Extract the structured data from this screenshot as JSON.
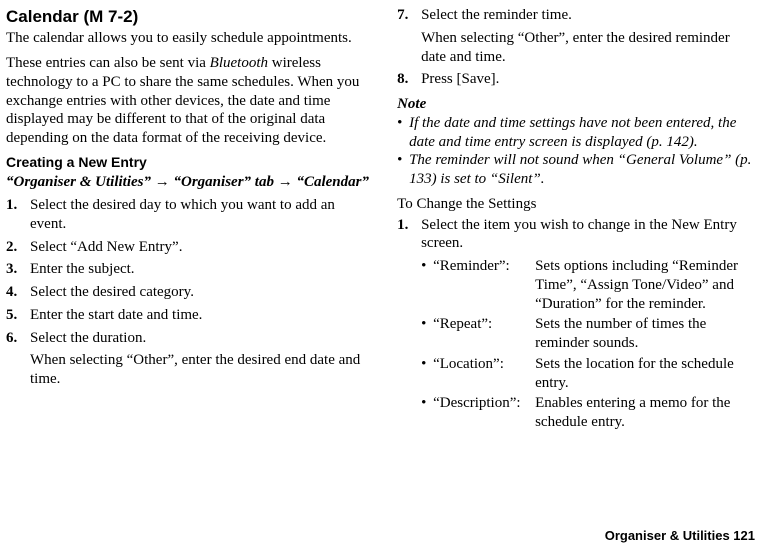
{
  "left": {
    "title": "Calendar",
    "menuCode": "(M 7-2)",
    "intro1": "The calendar allows you to easily schedule appointments.",
    "intro2_pre": "These entries can also be sent via ",
    "intro2_em": "Bluetooth",
    "intro2_post": " wireless technology to a PC to share the same schedules. When you exchange entries with other devices, the date and time displayed may be different to that of the original data depending on the data format of the receiving device.",
    "h2": "Creating a New Entry",
    "navPath": {
      "seg1": "“Organiser & Utilities”",
      "arrow": "→",
      "seg2": "“Organiser” tab",
      "seg3": "“Calendar”"
    },
    "steps": {
      "n1": "1.",
      "s1": "Select the desired day to which you want to add an event.",
      "n2": "2.",
      "s2": "Select “Add New Entry”.",
      "n3": "3.",
      "s3": "Enter the subject.",
      "n4": "4.",
      "s4": "Select the desired category.",
      "n5": "5.",
      "s5": "Enter the start date and time.",
      "n6": "6.",
      "s6": "Select the duration.",
      "s6b": "When selecting “Other”, enter the desired end date and time."
    }
  },
  "right": {
    "steps": {
      "n7": "7.",
      "s7": "Select the reminder time.",
      "s7b": "When selecting “Other”, enter the desired reminder date and time.",
      "n8": "8.",
      "s8": "Press [Save]."
    },
    "noteLabel": "Note",
    "notes": {
      "b1": "•",
      "n1": "If the date and time settings have not been entered, the date and time entry screen is displayed (p. 142).",
      "b2": "•",
      "n2": "The reminder will not sound when “General Volume” (p. 133) is set to “Silent”."
    },
    "h3": "To Change the Settings",
    "step1n": "1.",
    "step1": "Select the item you wish to change in the New Entry screen.",
    "defs": {
      "b": "•",
      "t1": "“Reminder”:",
      "d1": "Sets options including “Reminder Time”, “Assign Tone/Video” and “Duration” for the reminder.",
      "t2": "“Repeat”:",
      "d2": "Sets the number of times the reminder sounds.",
      "t3": "“Location”:",
      "d3": "Sets the location for the schedule entry.",
      "t4": "“Description”:",
      "d4": "Enables entering a memo for the schedule entry."
    }
  },
  "footer": "Organiser & Utilities   121"
}
